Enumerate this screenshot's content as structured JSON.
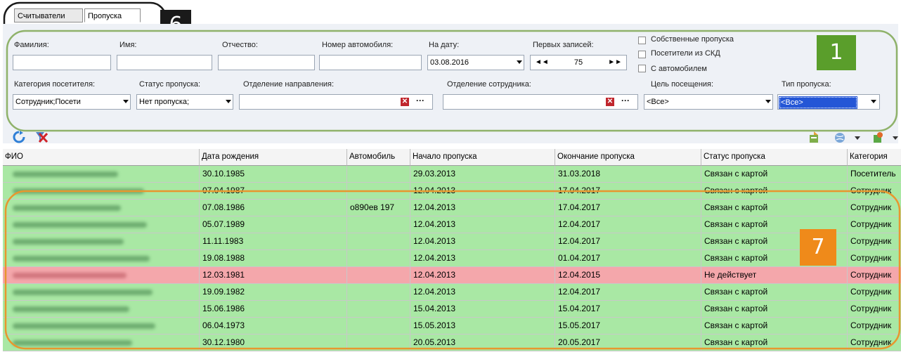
{
  "tabs": [
    {
      "label": "Считыватели"
    },
    {
      "label": "Пропуска"
    }
  ],
  "callouts": {
    "tabs_badge": "6",
    "filter_badge": "1",
    "grid_badge": "7"
  },
  "colors": {
    "badge_black": "#1a1a1a",
    "badge_green": "#5a9e2b",
    "badge_orange": "#ef8a1a",
    "outline_green": "#8fb26a",
    "outline_orange": "#e8962e",
    "row_green": "#a9e8a4",
    "row_red": "#f4a7ab",
    "selection_blue": "#2456d6"
  },
  "filters": {
    "surname_label": "Фамилия:",
    "name_label": "Имя:",
    "patronymic_label": "Отчество:",
    "car_number_label": "Номер автомобиля:",
    "on_date_label": "На дату:",
    "on_date_value": "03.08.2016",
    "first_records_label": "Первых записей:",
    "first_records_value": "75",
    "own_passes_label": "Собственные пропуска",
    "skd_visitors_label": "Посетители из СКД",
    "with_car_label": "С автомобилем",
    "visitor_category_label": "Категория посетителя:",
    "visitor_category_value": "Сотрудник;Посети",
    "pass_status_label": "Статус пропуска:",
    "pass_status_value": "Нет пропуска;",
    "referral_dept_label": "Отделение направления:",
    "employee_dept_label": "Отделение сотрудника:",
    "visit_purpose_label": "Цель посещения:",
    "visit_purpose_value": "<Все>",
    "pass_type_label": "Тип пропуска:",
    "pass_type_value": "<Все>"
  },
  "toolbar": {
    "refresh_icon": "refresh-icon",
    "clear_filter_icon": "clear-filter-icon"
  },
  "columns": [
    "ФИО",
    "Дата рождения",
    "Автомобиль",
    "Начало пропуска",
    "Окончание пропуска",
    "Статус пропуска",
    "Категория"
  ],
  "rows": [
    {
      "birth": "30.10.1985",
      "car": "",
      "start": "29.03.2013",
      "end": "31.03.2018",
      "status": "Связан с картой",
      "category": "Посетитель",
      "state": "green"
    },
    {
      "birth": "07.04.1987",
      "car": "",
      "start": "12.04.2013",
      "end": "17.04.2017",
      "status": "Связан с картой",
      "category": "Сотрудник",
      "state": "green"
    },
    {
      "birth": "07.08.1986",
      "car": "о890ев 197",
      "start": "12.04.2013",
      "end": "17.04.2017",
      "status": "Связан с картой",
      "category": "Сотрудник",
      "state": "green"
    },
    {
      "birth": "05.07.1989",
      "car": "",
      "start": "12.04.2013",
      "end": "12.04.2017",
      "status": "Связан с картой",
      "category": "Сотрудник",
      "state": "green"
    },
    {
      "birth": "11.11.1983",
      "car": "",
      "start": "12.04.2013",
      "end": "12.04.2017",
      "status": "Связан с картой",
      "category": "Сотрудник",
      "state": "green"
    },
    {
      "birth": "19.08.1988",
      "car": "",
      "start": "12.04.2013",
      "end": "01.04.2017",
      "status": "Связан с картой",
      "category": "Сотрудник",
      "state": "green"
    },
    {
      "birth": "12.03.1981",
      "car": "",
      "start": "12.04.2013",
      "end": "12.04.2015",
      "status": "Не действует",
      "category": "Сотрудник",
      "state": "red"
    },
    {
      "birth": "19.09.1982",
      "car": "",
      "start": "12.04.2013",
      "end": "12.04.2017",
      "status": "Связан с картой",
      "category": "Сотрудник",
      "state": "green"
    },
    {
      "birth": "15.06.1986",
      "car": "",
      "start": "15.04.2013",
      "end": "15.04.2017",
      "status": "Связан с картой",
      "category": "Сотрудник",
      "state": "green"
    },
    {
      "birth": "06.04.1973",
      "car": "",
      "start": "15.05.2013",
      "end": "15.05.2017",
      "status": "Связан с картой",
      "category": "Сотрудник",
      "state": "green"
    },
    {
      "birth": "30.12.1980",
      "car": "",
      "start": "20.05.2013",
      "end": "20.05.2017",
      "status": "Связан с картой",
      "category": "Сотрудник",
      "state": "green"
    }
  ]
}
